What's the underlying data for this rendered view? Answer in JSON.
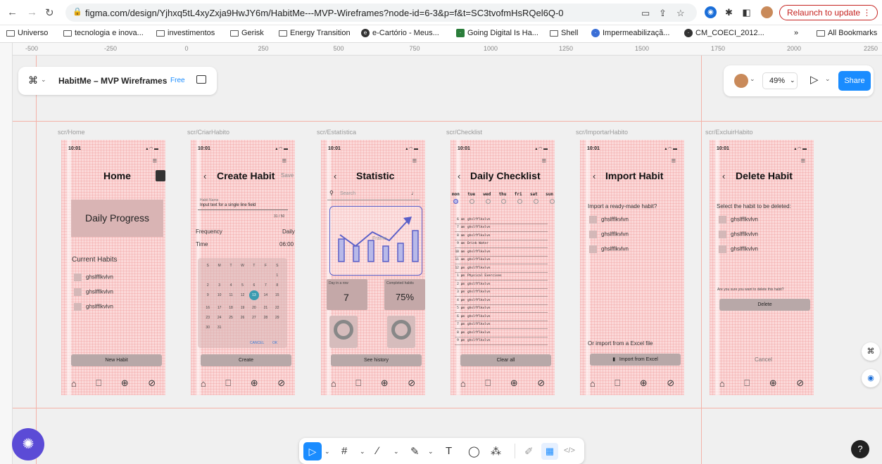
{
  "browser": {
    "url": "figma.com/design/Yjhxq5tL4xyZxja9HwJY6m/HabitMe---MVP-Wireframes?node-id=6-3&p=f&t=SC3tvofmHsRQel6Q-0",
    "relaunch_label": "Relaunch to update",
    "bookmarks": [
      "Universo",
      "tecnologia e inova...",
      "investimentos",
      "Gerisk",
      "Energy Transition",
      "e-Cartório - Meus...",
      "Going Digital Is Ha...",
      "Shell",
      "Impermeabilizaçã...",
      "CM_COECI_2012..."
    ],
    "all_bookmarks": "All Bookmarks",
    "overflow": "»"
  },
  "ruler": {
    "ticks": [
      "-500",
      "-250",
      "0",
      "250",
      "500",
      "750",
      "1000",
      "1250",
      "1500",
      "1750",
      "2000",
      "2250"
    ]
  },
  "file": {
    "name": "HabitMe – MVP Wireframes",
    "plan": "Free"
  },
  "view": {
    "zoom": "49%",
    "share_label": "Share"
  },
  "frames": {
    "home": {
      "label": "scr/Home",
      "time": "10:01",
      "title": "Home",
      "progress": "Daily Progress",
      "section": "Current Habits",
      "habits": [
        "ghslfflkvlvn",
        "ghslfflkvlvn",
        "ghslfflkvlvn"
      ],
      "button": "New Habit"
    },
    "create": {
      "label": "scr/CriarHabito",
      "time": "10:01",
      "title": "Create Habit",
      "save": "Save",
      "field_label": "Habit Name",
      "field_value": "Input text for a single line field",
      "counter": "31 / 50",
      "frequency": "Frequency",
      "frequency_value": "Daily",
      "time_label": "Time",
      "time_value": "06:00",
      "weekdays": [
        "S",
        "M",
        "T",
        "W",
        "T",
        "F",
        "S"
      ],
      "days": [
        "",
        "",
        "",
        "",
        "",
        "",
        "1",
        "2",
        "3",
        "4",
        "5",
        "6",
        "7",
        "8",
        "9",
        "10",
        "11",
        "12",
        "13",
        "14",
        "15",
        "16",
        "17",
        "18",
        "19",
        "20",
        "21",
        "22",
        "23",
        "24",
        "25",
        "26",
        "27",
        "28",
        "29",
        "30",
        "31"
      ],
      "cancel": "CANCEL",
      "ok": "OK",
      "button": "Create"
    },
    "stats": {
      "label": "scr/Estatística",
      "time": "10:01",
      "title": "Statistic",
      "search": "Search",
      "frame_text": "Frame",
      "card1_label": "Day in a row",
      "card1_value": "7",
      "card2_label": "Completed habits",
      "card2_value": "75%",
      "button": "See history"
    },
    "checklist": {
      "label": "scr/Checklist",
      "time": "10:01",
      "title": "Daily Checklist",
      "days": [
        "mon",
        "tue",
        "wed",
        "thu",
        "fri",
        "sat",
        "sun"
      ],
      "rows": [
        {
          "t": "6 am",
          "n": "ghslfflkvlvn"
        },
        {
          "t": "7 am",
          "n": "ghslfflkvlvn"
        },
        {
          "t": "8 am",
          "n": "ghslfflkvlvn"
        },
        {
          "t": "9 am",
          "n": "Drink Water"
        },
        {
          "t": "10 am",
          "n": "ghslfflkvlvn"
        },
        {
          "t": "11 am",
          "n": "ghslfflkvlvn"
        },
        {
          "t": "12 pm",
          "n": "ghslfflkvlvn"
        },
        {
          "t": "1 pm",
          "n": "Physical Exercises"
        },
        {
          "t": "2 pm",
          "n": "ghslfflkvlvn"
        },
        {
          "t": "3 pm",
          "n": "ghslfflkvlvn"
        },
        {
          "t": "4 pm",
          "n": "ghslfflkvlvn"
        },
        {
          "t": "5 pm",
          "n": "ghslfflkvlvn"
        },
        {
          "t": "6 pm",
          "n": "ghslfflkvlvn"
        },
        {
          "t": "7 pm",
          "n": "ghslfflkvlvn"
        },
        {
          "t": "8 pm",
          "n": "ghslfflkvlvn"
        },
        {
          "t": "9 pm",
          "n": "ghslfflkvlvn"
        }
      ],
      "button": "Clear all"
    },
    "import": {
      "label": "scr/ImportarHabito",
      "time": "10:01",
      "title": "Import Habit",
      "prompt": "Import a ready-made habit?",
      "habits": [
        "ghslfflkvlvn",
        "ghslfflkvlvn",
        "ghslfflkvlvn"
      ],
      "excel_text": "Or import from a Excel file",
      "button": "Import from Excel"
    },
    "delete": {
      "label": "scr/ExcluirHabito",
      "time": "10:01",
      "title": "Delete Habit",
      "prompt": "Select the habit to be deleted:",
      "habits": [
        "ghslfflkvlvn",
        "ghslfflkvlvn",
        "ghslfflkvlvn"
      ],
      "confirm": "Are you sure you want to delete this habit?",
      "button": "Delete",
      "cancel": "Cancel"
    }
  },
  "help": "?",
  "colors": {
    "accent": "#1a8cff",
    "frame_bg": "#fbd9d9",
    "guide": "#f4b2a8",
    "stat_blue": "#5a5fc8",
    "selected_day": "#3a9bb0"
  }
}
